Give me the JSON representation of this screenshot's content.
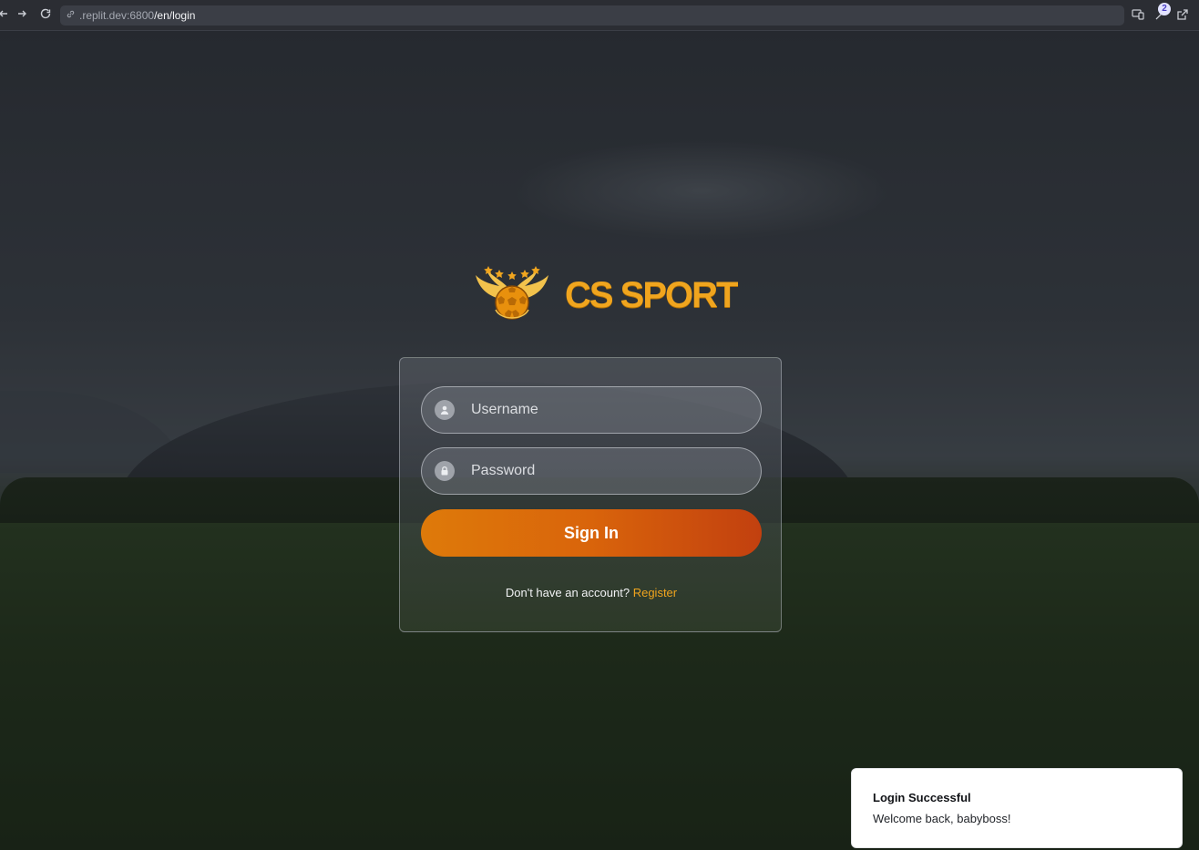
{
  "browser": {
    "url_host": ".replit.dev:6800",
    "url_path": "/en/login",
    "badge_count": "2",
    "icons": [
      "back-icon",
      "forward-icon",
      "reload-icon",
      "link-icon",
      "devices-icon",
      "extension-icon",
      "open-external-icon"
    ]
  },
  "brand": {
    "name": "CS SPORT",
    "color": "#f0a51e"
  },
  "login": {
    "username_placeholder": "Username",
    "password_placeholder": "Password",
    "signin_label": "Sign In",
    "no_account_text": "Don't have an account?",
    "register_label": "Register",
    "accent_color": "#f0a51e",
    "button_gradient": [
      "#de7a0a",
      "#c2400f"
    ]
  },
  "toast": {
    "title": "Login Successful",
    "message": "Welcome back, babyboss!"
  }
}
